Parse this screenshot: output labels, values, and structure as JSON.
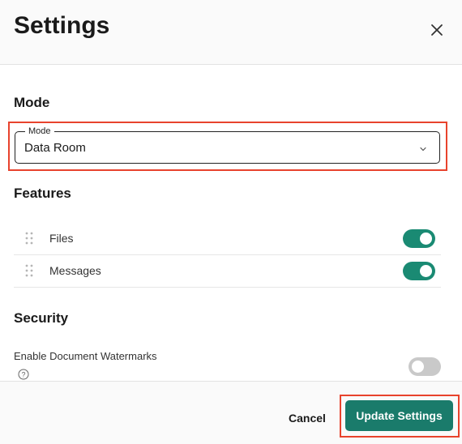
{
  "header": {
    "title": "Settings"
  },
  "mode": {
    "section_title": "Mode",
    "select_label": "Mode",
    "selected_value": "Data Room"
  },
  "features": {
    "section_title": "Features",
    "items": [
      {
        "label": "Files",
        "enabled": true
      },
      {
        "label": "Messages",
        "enabled": true
      }
    ]
  },
  "security": {
    "section_title": "Security",
    "watermark_label": "Enable Document Watermarks",
    "watermark_enabled": false
  },
  "footer": {
    "cancel_label": "Cancel",
    "update_label": "Update Settings"
  },
  "colors": {
    "accent": "#1a7b6b",
    "toggle_on": "#1a8a73",
    "toggle_off": "#c9c9c9",
    "highlight": "#e8432d"
  },
  "icons": [
    "close-icon",
    "chevron-down-icon",
    "drag-handle-icon",
    "help-icon"
  ]
}
